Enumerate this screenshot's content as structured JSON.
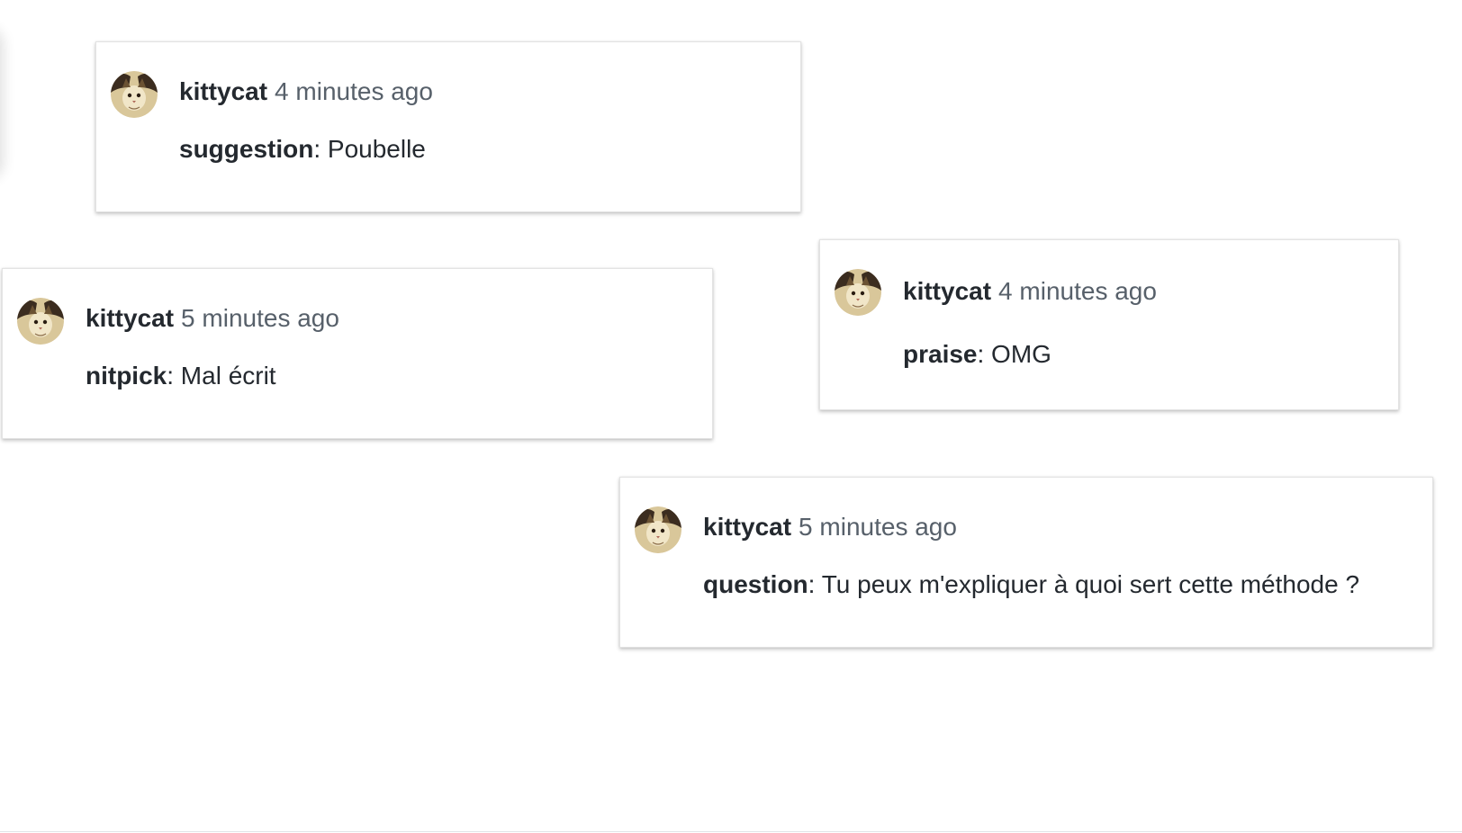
{
  "comments": [
    {
      "author": "kittycat",
      "time": "4 minutes ago",
      "label": "suggestion",
      "separator": ":",
      "text": " Poubelle"
    },
    {
      "author": "kittycat",
      "time": "5 minutes ago",
      "label": "nitpick",
      "separator": ":",
      "text": " Mal écrit"
    },
    {
      "author": "kittycat",
      "time": "4 minutes ago",
      "label": "praise",
      "separator": ":",
      "text": " OMG"
    },
    {
      "author": "kittycat",
      "time": "5 minutes ago",
      "label": "question",
      "separator": ":",
      "text": " Tu peux m'expliquer à quoi sert cette méthode ?"
    }
  ],
  "colors": {
    "author": "#24292f",
    "timestamp": "#57606a",
    "card_background": "#ffffff"
  },
  "icons": {
    "avatar": "cat-avatar-icon"
  }
}
